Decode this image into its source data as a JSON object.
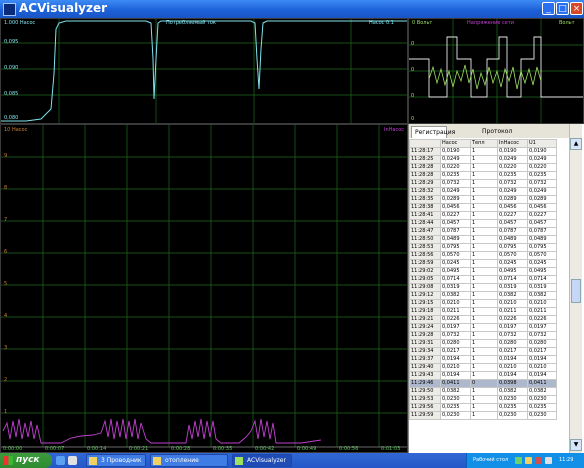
{
  "window": {
    "title": "ACVisualyzer",
    "btn_min": "_",
    "btn_max": "□",
    "btn_close": "×"
  },
  "colors": {
    "grid": "#1f6b1f",
    "cyan": "#7fe3ee",
    "magenta": "#c040d0",
    "green": "#9ee060",
    "trace_white": "#e8e8e8"
  },
  "top_left_panel": {
    "label_left": "1.000 Насос",
    "label_center": "Потребляемый ток",
    "label_right": "Насос 0.1",
    "y_ticks": [
      "0,095",
      "0,090",
      "0,085",
      "0,080"
    ]
  },
  "top_right_panel": {
    "label_left": "0  Вольт",
    "label_center": "Напряжение сети",
    "label_right": "Вольт",
    "y_ticks": [
      "0",
      "0",
      "0",
      "0"
    ]
  },
  "main_panel": {
    "label_left": "10  Насос",
    "label_right": "InНасос",
    "x_ticks": [
      "0:00:00",
      "0:00:07",
      "0:00:14",
      "0:00:21",
      "0:00:28",
      "0:00:35",
      "0:00:42",
      "0:00:49",
      "0:00:56",
      "0:01:03"
    ],
    "left_marks": [
      "9",
      "8",
      "7",
      "6",
      "5",
      "4",
      "3",
      "2",
      "1"
    ]
  },
  "table": {
    "tabs": [
      "Регистрация",
      "Протокол"
    ],
    "columns": [
      "",
      "Насос",
      "Тепл",
      "InНасос",
      "U1"
    ],
    "rows": [
      [
        "11:28:17",
        "0,0190",
        "1",
        "0,0190",
        "0,0190"
      ],
      [
        "11:28:25",
        "0,0249",
        "1",
        "0,0249",
        "0,0249"
      ],
      [
        "11:28:28",
        "0,0220",
        "1",
        "0,0220",
        "0,0220"
      ],
      [
        "11:28:28",
        "0,0235",
        "1",
        "0,0235",
        "0,0235"
      ],
      [
        "11:28:29",
        "0,0732",
        "1",
        "0,0732",
        "0,0732"
      ],
      [
        "11:28:32",
        "0,0249",
        "1",
        "0,0249",
        "0,0249"
      ],
      [
        "11:28:35",
        "0,0289",
        "1",
        "0,0289",
        "0,0289"
      ],
      [
        "11:28:38",
        "0,0456",
        "1",
        "0,0456",
        "0,0456"
      ],
      [
        "11:28:41",
        "0,0227",
        "1",
        "0,0227",
        "0,0227"
      ],
      [
        "11:28:44",
        "0,0457",
        "1",
        "0,0457",
        "0,0457"
      ],
      [
        "11:28:47",
        "0,0787",
        "1",
        "0,0787",
        "0,0787"
      ],
      [
        "11:28:50",
        "0,0489",
        "1",
        "0,0489",
        "0,0489"
      ],
      [
        "11:28:53",
        "0,0795",
        "1",
        "0,0795",
        "0,0795"
      ],
      [
        "11:28:56",
        "0,0570",
        "1",
        "0,0570",
        "0,0570"
      ],
      [
        "11:28:59",
        "0,0245",
        "1",
        "0,0245",
        "0,0245"
      ],
      [
        "11:29:02",
        "0,0495",
        "1",
        "0,0495",
        "0,0495"
      ],
      [
        "11:29:05",
        "0,0714",
        "1",
        "0,0714",
        "0,0714"
      ],
      [
        "11:29:08",
        "0,0319",
        "1",
        "0,0319",
        "0,0319"
      ],
      [
        "11:29:12",
        "0,0382",
        "1",
        "0,0382",
        "0,0382"
      ],
      [
        "11:29:15",
        "0,0210",
        "1",
        "0,0210",
        "0,0210"
      ],
      [
        "11:29:18",
        "0,0211",
        "1",
        "0,0211",
        "0,0211"
      ],
      [
        "11:29:21",
        "0,0226",
        "1",
        "0,0226",
        "0,0226"
      ],
      [
        "11:29:24",
        "0,0197",
        "1",
        "0,0197",
        "0,0197"
      ],
      [
        "11:29:28",
        "0,0732",
        "1",
        "0,0732",
        "0,0732"
      ],
      [
        "11:29:31",
        "0,0280",
        "1",
        "0,0280",
        "0,0280"
      ],
      [
        "11:29:34",
        "0,0217",
        "1",
        "0,0217",
        "0,0217"
      ],
      [
        "11:29:37",
        "0,0194",
        "1",
        "0,0194",
        "0,0194"
      ],
      [
        "11:29:40",
        "0,0210",
        "1",
        "0,0210",
        "0,0210"
      ],
      [
        "11:29:43",
        "0,0194",
        "1",
        "0,0194",
        "0,0194"
      ],
      [
        "11:29:46",
        "0,0411",
        "0",
        "0,0398",
        "0,0411"
      ],
      [
        "11:29:50",
        "0,0382",
        "1",
        "0,0382",
        "0,0382"
      ],
      [
        "11:29:53",
        "0,0230",
        "1",
        "0,0230",
        "0,0230"
      ],
      [
        "11:29:56",
        "0,0235",
        "1",
        "0,0235",
        "0,0235"
      ],
      [
        "11:29:59",
        "0,0230",
        "1",
        "0,0230",
        "0,0230"
      ]
    ],
    "selected_row": 29
  },
  "taskbar": {
    "start_label": "пуск",
    "tasks": [
      "3 Проводник",
      "отопление",
      "ACVisualyzer"
    ],
    "tray_text": "Рабочий стол",
    "clock": "11:29"
  }
}
